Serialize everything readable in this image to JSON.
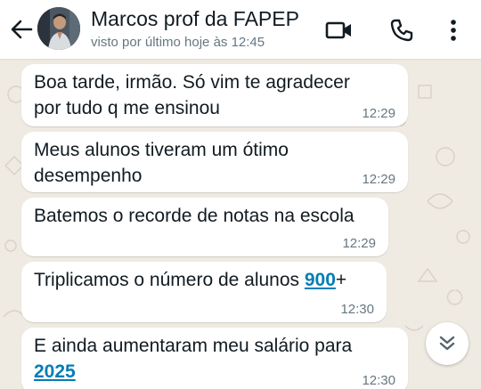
{
  "header": {
    "contact_name": "Marcos prof da FAPEP",
    "last_seen": "visto por último hoje às 12:45",
    "icons": [
      "back-arrow-icon",
      "video-call-icon",
      "phone-icon",
      "more-options-icon"
    ]
  },
  "messages": [
    {
      "text": "Boa tarde, irmão. Só vim te agradecer\npor tudo q me ensinou",
      "time": "12:29"
    },
    {
      "text": "Meus alunos tiveram um ótimo\ndesempenho",
      "time": "12:29"
    },
    {
      "text": "Batemos o recorde de notas na escola",
      "time": "12:29"
    },
    {
      "text_before": "Triplicamos o número de alunos ",
      "link": "900",
      "text_after": "+",
      "time": "12:30"
    },
    {
      "text_before": "E ainda aumentaram meu salário para\n",
      "link": "2025",
      "text_after": "",
      "time": "12:30"
    }
  ],
  "scroll_button": {
    "icon": "double-chevron-down-icon"
  },
  "colors": {
    "chat_background": "#efeae2",
    "bubble": "#ffffff",
    "link": "#027eb5",
    "icon": "#111b21",
    "secondary_text": "#667781"
  }
}
